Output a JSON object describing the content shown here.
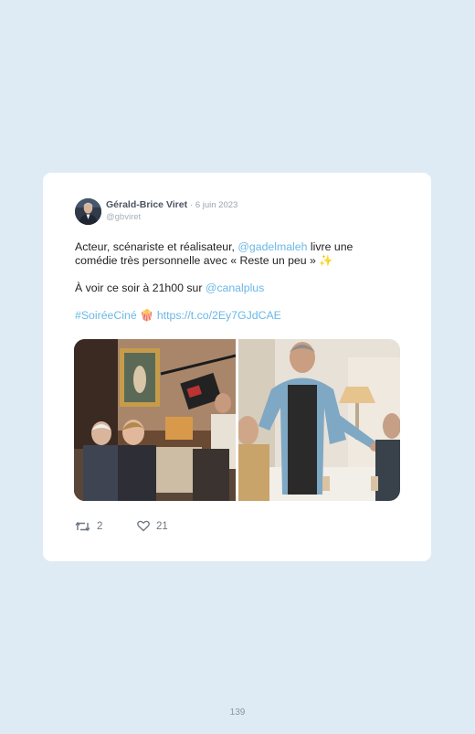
{
  "tweet": {
    "author_name": "Gérald-Brice Viret",
    "date": "· 6 juin 2023",
    "handle": "@gbviret",
    "line1_pre": "Acteur, scénariste et réalisateur, ",
    "line1_mention": "@gadelmaleh",
    "line1_post": " livre une",
    "line2": "comédie très personnelle avec « Reste un peu » ✨",
    "line3_pre": "À voir ce soir à 21h00 sur ",
    "line3_mention": "@canalplus",
    "hashtag": "#SoiréeCiné",
    "popcorn": "🍿",
    "url": "https://t.co/2Ey7GJdCAE",
    "retweet_count": "2",
    "like_count": "21"
  },
  "page_number": "139",
  "colors": {
    "background": "#deebf4",
    "card": "#ffffff",
    "link": "#6ab8e6",
    "meta": "#9aa3ad"
  },
  "icons": [
    "retweet-icon",
    "heart-icon"
  ]
}
